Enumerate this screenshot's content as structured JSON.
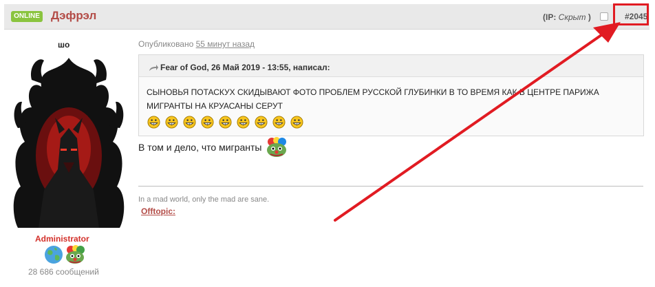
{
  "header": {
    "online_badge": "ONLINE",
    "author_name": "Дэфрэл",
    "ip_label": "(IP: ",
    "ip_value": "Скрыт",
    "ip_close": " )",
    "post_number": "#2045"
  },
  "user": {
    "title": "шо",
    "rank": "Administrator",
    "post_count": "28 686 сообщений",
    "badge_icons": [
      "globe-icon",
      "pepe-clown-icon"
    ]
  },
  "post": {
    "published_prefix": "Опубликовано ",
    "published_time": "55 минут назад",
    "quote": {
      "author_line": "Fear of God, 26 Май 2019 - 13:55, написал:",
      "text": "СЫНОВЬЯ ПОТАСКУХ СКИДЫВАЮТ ФОТО ПРОБЛЕМ РУССКОЙ ГЛУБИНКИ В ТО ВРЕМЯ КАК В ЦЕНТРЕ ПАРИЖА МИГРАНТЫ НА КРУАСАНЫ СЕРУТ",
      "smiley_count": 9
    },
    "reply_text": "В том и дело, что мигранты",
    "signature_text": "In a mad world, only the mad are sane.",
    "signature_link": "Offtopic:"
  },
  "colors": {
    "accent": "#b34c47",
    "online": "#8ac43f",
    "rank": "#d3302a",
    "annotation": "#e11b22"
  }
}
